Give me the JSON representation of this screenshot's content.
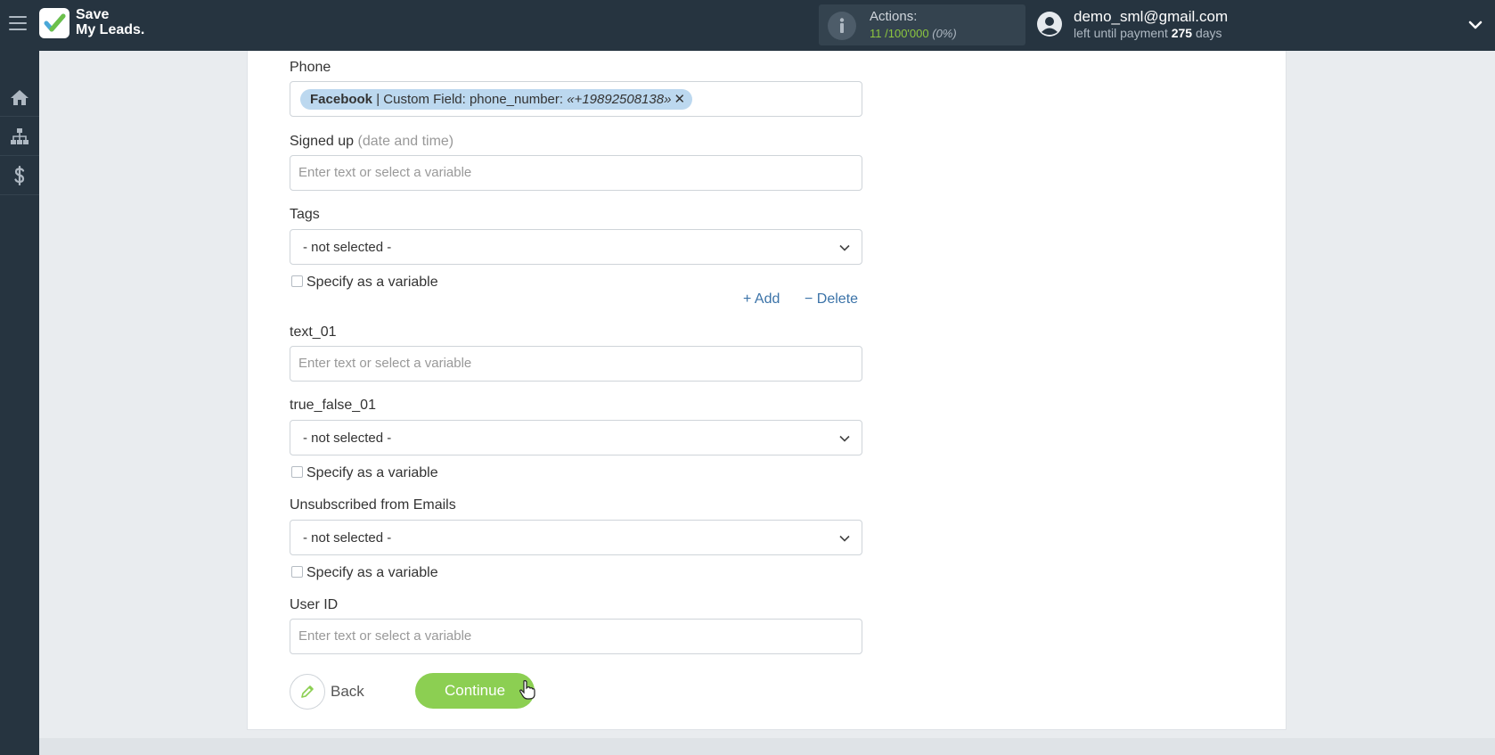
{
  "header": {
    "brand_line1": "Save",
    "brand_line2": "My Leads.",
    "actions_label": "Actions:",
    "actions_used": "11",
    "actions_total": "/100'000",
    "actions_percent": "(0%)",
    "user_email": "demo_sml@gmail.com",
    "payment_prefix": "left until payment",
    "payment_days": "275",
    "payment_suffix": "days"
  },
  "sidebar": {
    "items": [
      {
        "icon": "home-icon"
      },
      {
        "icon": "sitemap-icon"
      },
      {
        "icon": "dollar-icon"
      }
    ]
  },
  "form": {
    "phone": {
      "label": "Phone",
      "tag_source": "Facebook",
      "tag_field": " | Custom Field: phone_number: ",
      "tag_value": "«+19892508138»",
      "tag_remove": "✕"
    },
    "signed_up": {
      "label": "Signed up",
      "hint": "(date and time)",
      "placeholder": "Enter text or select a variable"
    },
    "tags": {
      "label": "Tags",
      "value": "- not selected -",
      "specify_label": "Specify as a variable"
    },
    "add_label": "+ Add",
    "delete_label": "− Delete",
    "text_01": {
      "label": "text_01",
      "placeholder": "Enter text or select a variable"
    },
    "true_false_01": {
      "label": "true_false_01",
      "value": "- not selected -",
      "specify_label": "Specify as a variable"
    },
    "unsubscribed": {
      "label": "Unsubscribed from Emails",
      "value": "- not selected -",
      "specify_label": "Specify as a variable"
    },
    "user_id": {
      "label": "User ID",
      "placeholder": "Enter text or select a variable"
    },
    "back_label": "Back",
    "continue_label": "Continue"
  },
  "colors": {
    "topbar": "#263440",
    "accent_green": "#8ccf52",
    "link_blue": "#3b73a8",
    "tag_bg": "#bcd8ef"
  }
}
